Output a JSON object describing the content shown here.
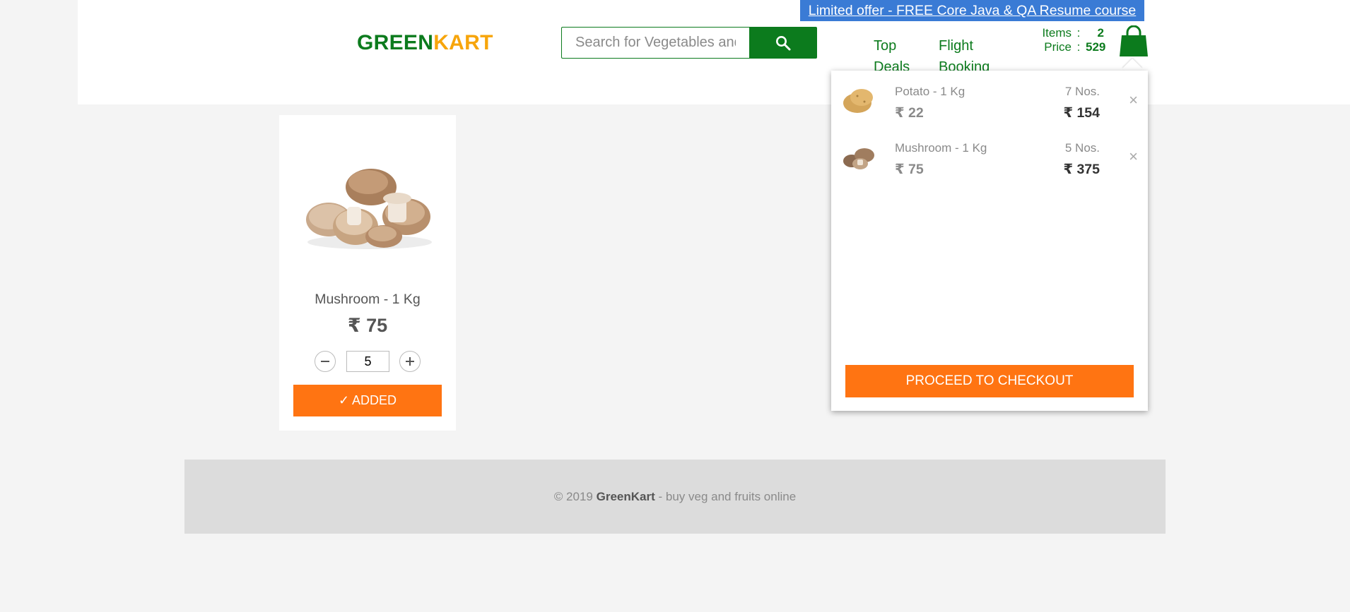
{
  "promo": {
    "text": "Limited offer - FREE Core Java & QA Resume course"
  },
  "logo": {
    "part1": "GREEN",
    "part2": "KART"
  },
  "search": {
    "placeholder": "Search for Vegetables and Fruits",
    "icon": "search-icon"
  },
  "nav": {
    "top_deals": "Top Deals",
    "flight_booking": "Flight Booking"
  },
  "stats": {
    "items_label": "Items",
    "items_value": "2",
    "price_label": "Price",
    "price_value": "529",
    "separator": ":"
  },
  "colors": {
    "brand_green": "#0c7b1d",
    "brand_orange": "#f7a50b",
    "button_orange": "#ff7412",
    "promo_blue": "#3a7bd5"
  },
  "product": {
    "name": "Mushroom - 1 Kg",
    "price": "₹ 75",
    "quantity": "5",
    "button": "✓ ADDED"
  },
  "cart": {
    "items": [
      {
        "name": "Potato - 1 Kg",
        "price": "₹ 22",
        "qty": "7 Nos.",
        "amount": "₹ 154"
      },
      {
        "name": "Mushroom - 1 Kg",
        "price": "₹ 75",
        "qty": "5 Nos.",
        "amount": "₹ 375"
      }
    ],
    "remove_glyph": "×",
    "checkout": "PROCEED TO CHECKOUT"
  },
  "footer": {
    "copyright": "© 2019",
    "brand": "GreenKart",
    "tagline": "- buy veg and fruits online"
  }
}
